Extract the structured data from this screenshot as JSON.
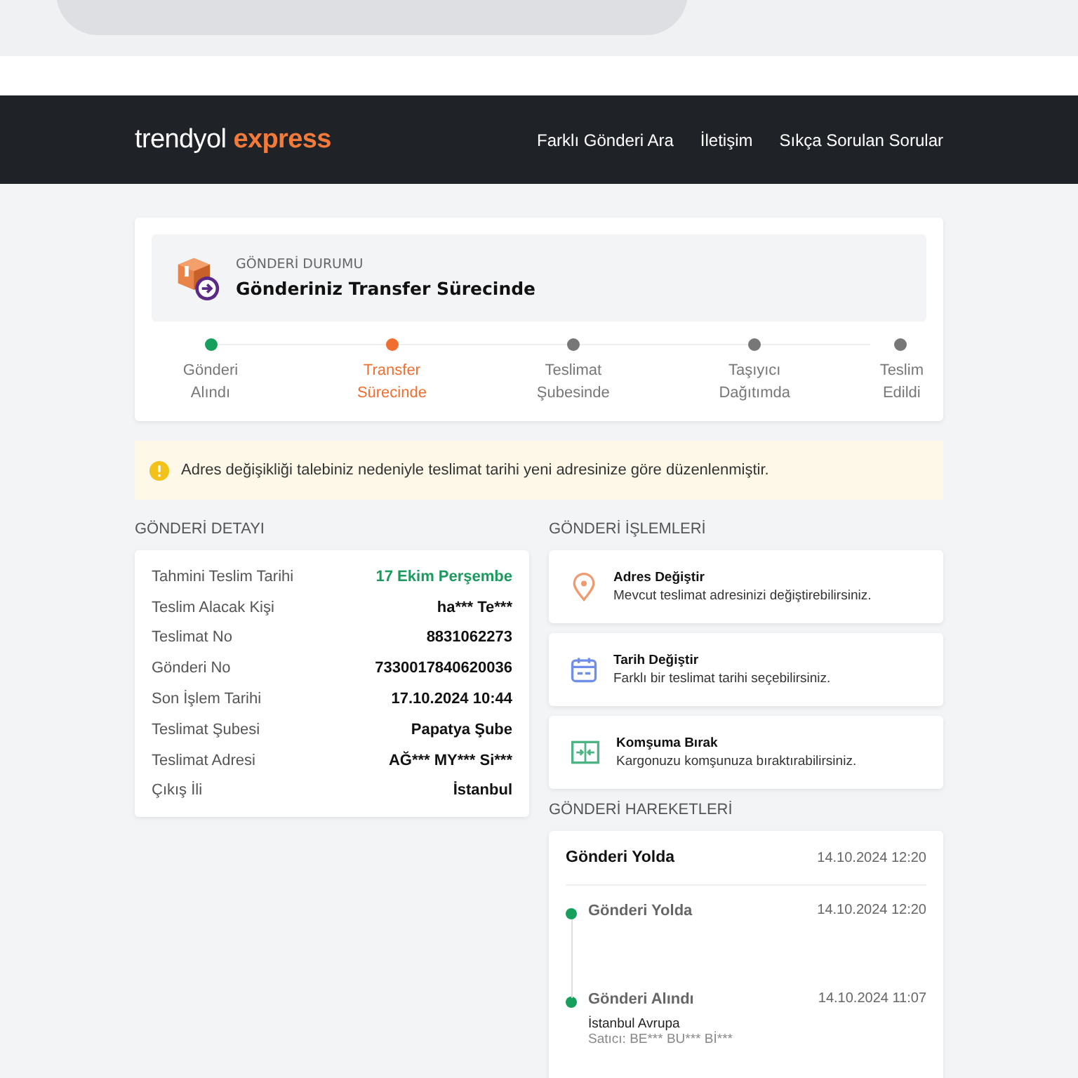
{
  "header": {
    "logo_main": "trendyol",
    "logo_accent": "express",
    "nav": [
      "Farklı Gönderi Ara",
      "İletişim",
      "Sıkça Sorulan Sorular"
    ]
  },
  "status": {
    "label": "GÖNDERİ DURUMU",
    "title": "Gönderiniz Transfer Sürecinde",
    "steps": [
      {
        "label": "Gönderi Alındı",
        "kind": "done"
      },
      {
        "label": "Transfer Sürecinde",
        "kind": "current"
      },
      {
        "label": "Teslimat Şubesinde",
        "kind": "pending"
      },
      {
        "label": "Taşıyıcı Dağıtımda",
        "kind": "pending"
      },
      {
        "label": "Teslim Edildi",
        "kind": "pending"
      }
    ]
  },
  "notice": "Adres değişikliği talebiniz nedeniyle teslimat tarihi yeni adresinize göre düzenlenmiştir.",
  "detail": {
    "title": "GÖNDERİ DETAYI",
    "rows": [
      {
        "label": "Tahmini Teslim Tarihi",
        "value": "17 Ekim Perşembe",
        "highlight": true
      },
      {
        "label": "Teslim Alacak Kişi",
        "value": "ha*** Te***",
        "highlight": false
      },
      {
        "label": "Teslimat No",
        "value": "8831062273",
        "highlight": false
      },
      {
        "label": "Gönderi No",
        "value": "7330017840620036",
        "highlight": false
      },
      {
        "label": "Son İşlem Tarihi",
        "value": "17.10.2024 10:44",
        "highlight": false
      },
      {
        "label": "Teslimat Şubesi",
        "value": "Papatya Şube",
        "highlight": false
      },
      {
        "label": "Teslimat Adresi",
        "value": "AĞ*** MY*** Si***",
        "highlight": false
      },
      {
        "label": "Çıkış İli",
        "value": "İstanbul",
        "highlight": false
      }
    ]
  },
  "actions": {
    "title": "GÖNDERİ İŞLEMLERİ",
    "items": [
      {
        "kind": "address",
        "title": "Adres Değiştir",
        "text": "Mevcut teslimat adresinizi değiştirebilirsiniz."
      },
      {
        "kind": "date",
        "title": "Tarih Değiştir",
        "text": "Farklı bir teslimat tarihi seçebilirsiniz."
      },
      {
        "kind": "neighbor",
        "title": "Komşuma Bırak",
        "text": "Kargonuzu komşunuza bıraktırabilirsiniz."
      }
    ]
  },
  "movements": {
    "title": "GÖNDERİ HAREKETLERİ",
    "current": {
      "title": "Gönderi Yolda",
      "date": "14.10.2024 12:20"
    },
    "events": [
      {
        "title": "Gönderi Yolda",
        "date": "14.10.2024 12:20"
      },
      {
        "title": "Gönderi Alındı",
        "date": "14.10.2024 11:07",
        "location": "İstanbul Avrupa",
        "seller": "Satıcı: BE*** BU*** Bİ***"
      }
    ]
  }
}
